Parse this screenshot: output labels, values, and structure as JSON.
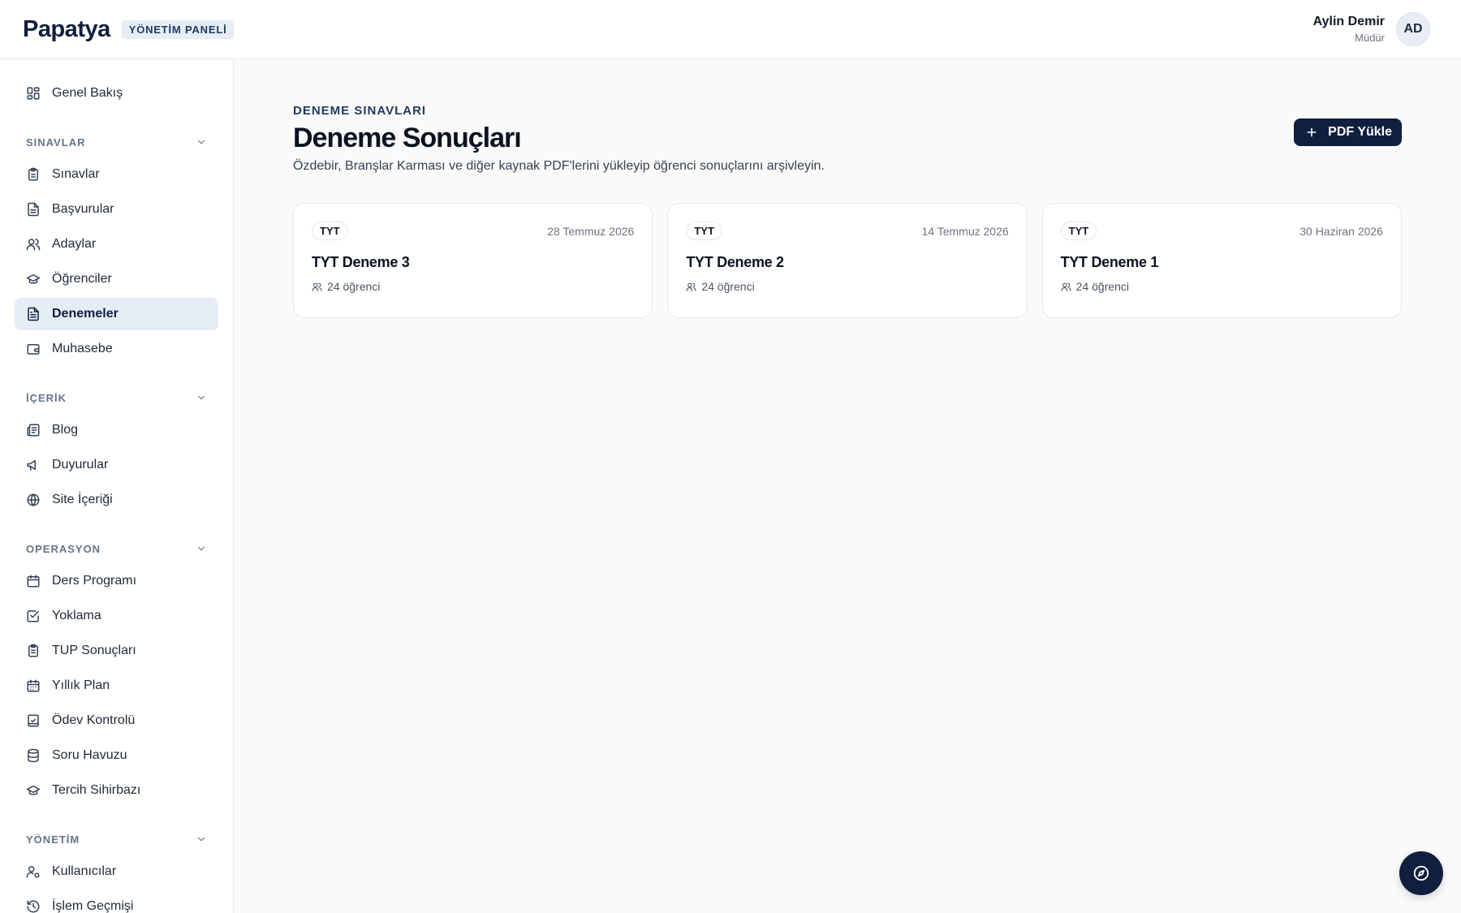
{
  "header": {
    "brand": "Papatya",
    "badge": "YÖNETİM PANELİ",
    "user_name": "Aylin Demir",
    "user_role": "Müdür",
    "avatar_initials": "AD"
  },
  "sidebar": {
    "overview": "Genel Bakış",
    "sections": {
      "exams": {
        "title": "SINAVLAR",
        "items": [
          "Sınavlar",
          "Başvurular",
          "Adaylar",
          "Öğrenciler",
          "Denemeler",
          "Muhasebe"
        ]
      },
      "content": {
        "title": "İÇERİK",
        "items": [
          "Blog",
          "Duyurular",
          "Site İçeriği"
        ]
      },
      "operations": {
        "title": "OPERASYON",
        "items": [
          "Ders Programı",
          "Yoklama",
          "TUP Sonuçları",
          "Yıllık Plan",
          "Ödev Kontrolü",
          "Soru Havuzu",
          "Tercih Sihirbazı"
        ]
      },
      "management": {
        "title": "YÖNETİM",
        "items": [
          "Kullanıcılar",
          "İşlem Geçmişi"
        ]
      }
    },
    "active_item": "Denemeler"
  },
  "main": {
    "eyebrow": "DENEME SINAVLARI",
    "title": "Deneme Sonuçları",
    "description": "Özdebir, Branşlar Karması ve diğer kaynak PDF'lerini yükleyip öğrenci sonuçlarını arşivleyin.",
    "upload_label": "PDF Yükle",
    "cards": [
      {
        "tag": "TYT",
        "date": "28 Temmuz 2026",
        "title": "TYT Deneme 3",
        "students": "24 öğrenci"
      },
      {
        "tag": "TYT",
        "date": "14 Temmuz 2026",
        "title": "TYT Deneme 2",
        "students": "24 öğrenci"
      },
      {
        "tag": "TYT",
        "date": "30 Haziran 2026",
        "title": "TYT Deneme 1",
        "students": "24 öğrenci"
      }
    ]
  },
  "colors": {
    "brand_navy": "#0f1f3d",
    "active_bg": "#e5ecf6"
  }
}
